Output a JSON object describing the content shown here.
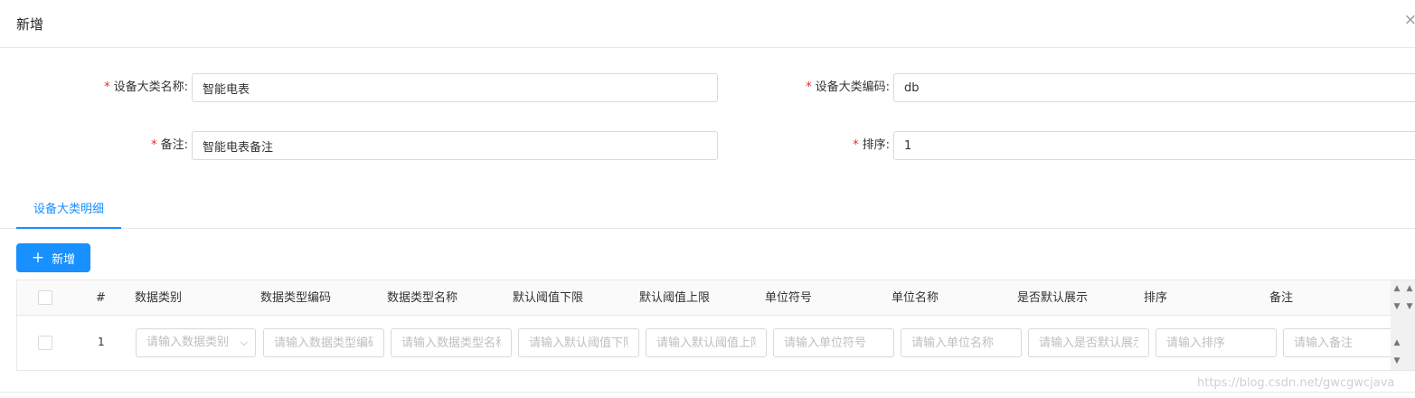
{
  "modal": {
    "title": "新增",
    "close_glyph": "×"
  },
  "form": {
    "category_name": {
      "label": "设备大类名称:",
      "value": "智能电表"
    },
    "category_code": {
      "label": "设备大类编码:",
      "value": "db"
    },
    "remark": {
      "label": "备注:",
      "value": "智能电表备注"
    },
    "sort": {
      "label": "排序:",
      "value": "1"
    },
    "required_mark": "*"
  },
  "tabs": [
    {
      "label": "设备大类明细",
      "active": true
    }
  ],
  "add_button": {
    "label": "新增",
    "icon": "plus-icon"
  },
  "table": {
    "columns": [
      "#",
      "数据类别",
      "数据类型编码",
      "数据类型名称",
      "默认阈值下限",
      "默认阈值上限",
      "单位符号",
      "单位名称",
      "是否默认展示",
      "排序",
      "备注"
    ],
    "rows": [
      {
        "index": "1",
        "select_placeholder": "请输入数据类别",
        "placeholders": [
          "请输入数据类型编码",
          "请输入数据类型名称",
          "请输入默认阈值下限",
          "请输入默认阈值上限",
          "请输入单位符号",
          "请输入单位名称",
          "请输入是否默认展示",
          "请输入排序",
          "请输入备注"
        ]
      }
    ]
  },
  "watermark": "https://blog.csdn.net/gwcgwcjava",
  "colors": {
    "primary": "#1890ff",
    "required": "#f5222d",
    "border": "#d9d9d9"
  }
}
